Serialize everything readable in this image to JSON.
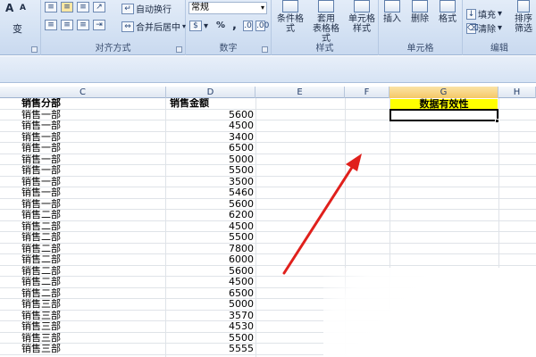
{
  "ribbon": {
    "font": {
      "grow_label": "A",
      "shrink_label": "A",
      "underline_label": "变"
    },
    "alignment": {
      "group_label": "对齐方式",
      "wrap_text": "自动换行",
      "merge_center": "合并后居中"
    },
    "number": {
      "group_label": "数字",
      "format_value": "常规",
      "percent": "%",
      "comma": ",",
      "currency": "$"
    },
    "styles": {
      "group_label": "样式",
      "conditional": "条件格式",
      "table_format_1": "套用",
      "table_format_2": "表格格式",
      "cell_style_1": "单元格",
      "cell_style_2": "样式"
    },
    "cells": {
      "group_label": "单元格",
      "insert": "插入",
      "delete": "删除",
      "format": "格式"
    },
    "editing": {
      "group_label": "编辑",
      "fill": "填充",
      "clear": "清除",
      "sort_1": "排序",
      "sort_2": "筛选"
    }
  },
  "columns": [
    "C",
    "D",
    "E",
    "F",
    "G",
    "H"
  ],
  "selected_column": "G",
  "header_row": {
    "c": "销售分部",
    "d": "销售金额",
    "g": "数据有效性"
  },
  "rows": [
    {
      "c": "销售一部",
      "d": "5600"
    },
    {
      "c": "销售一部",
      "d": "4500"
    },
    {
      "c": "销售一部",
      "d": "3400"
    },
    {
      "c": "销售一部",
      "d": "6500"
    },
    {
      "c": "销售一部",
      "d": "5000"
    },
    {
      "c": "销售一部",
      "d": "5500"
    },
    {
      "c": "销售一部",
      "d": "3500"
    },
    {
      "c": "销售一部",
      "d": "5460"
    },
    {
      "c": "销售一部",
      "d": "5600"
    },
    {
      "c": "销售二部",
      "d": "6200"
    },
    {
      "c": "销售二部",
      "d": "4500"
    },
    {
      "c": "销售二部",
      "d": "5500"
    },
    {
      "c": "销售二部",
      "d": "7800"
    },
    {
      "c": "销售二部",
      "d": "6000"
    },
    {
      "c": "销售二部",
      "d": "5600"
    },
    {
      "c": "销售二部",
      "d": "4500"
    },
    {
      "c": "销售二部",
      "d": "6500"
    },
    {
      "c": "销售三部",
      "d": "5000"
    },
    {
      "c": "销售三部",
      "d": "3570"
    },
    {
      "c": "销售三部",
      "d": "4530"
    },
    {
      "c": "销售三部",
      "d": "5500"
    },
    {
      "c": "销售三部",
      "d": "5555"
    }
  ],
  "colors": {
    "highlight": "#ffff00",
    "arrow": "#e0201c",
    "ribbon": "#d3e1f3"
  }
}
